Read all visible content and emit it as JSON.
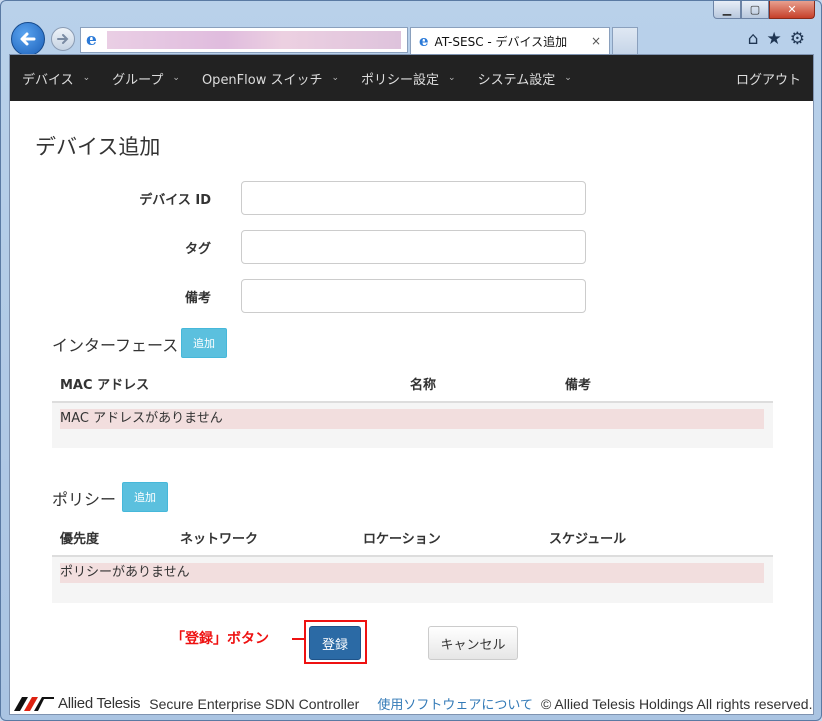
{
  "browser": {
    "tab_title": "AT-SESC - デバイス追加",
    "tab_close": "×",
    "address_text": ""
  },
  "navbar": {
    "items": [
      {
        "label": "デバイス"
      },
      {
        "label": "グループ"
      },
      {
        "label": "OpenFlow スイッチ"
      },
      {
        "label": "ポリシー設定"
      },
      {
        "label": "システム設定"
      }
    ],
    "logout": "ログアウト"
  },
  "page": {
    "title": "デバイス追加"
  },
  "form": {
    "device_id_label": "デバイス ID",
    "tag_label": "タグ",
    "note_label": "備考"
  },
  "interfaces": {
    "title": "インターフェース",
    "add_label": "追加",
    "columns": [
      "MAC アドレス",
      "名称",
      "備考"
    ],
    "empty_message": "MAC アドレスがありません"
  },
  "policies": {
    "title": "ポリシー",
    "add_label": "追加",
    "columns": [
      "優先度",
      "ネットワーク",
      "ロケーション",
      "スケジュール"
    ],
    "empty_message": "ポリシーがありません"
  },
  "actions": {
    "register_label": "登録",
    "cancel_label": "キャンセル",
    "annotation": "「登録」ボタン"
  },
  "footer": {
    "brand": "Allied Telesis",
    "product": "Secure Enterprise SDN Controller",
    "about_link": "使用ソフトウェアについて",
    "copyright": "© Allied Telesis Holdings All rights reserved."
  },
  "colors": {
    "navbar_bg": "#222222",
    "info_button": "#5bc0de",
    "primary_button": "#2b6aa5",
    "empty_row": "#f2dede",
    "annotation": "#ee1111"
  }
}
